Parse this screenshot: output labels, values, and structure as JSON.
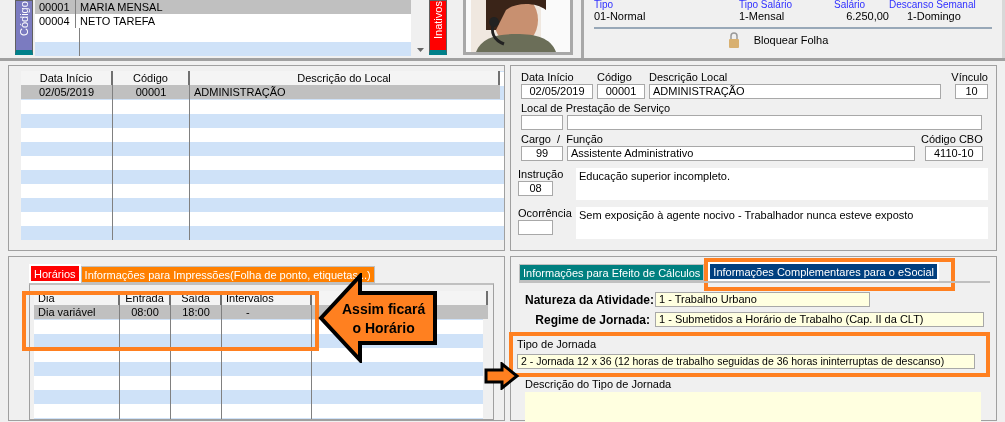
{
  "employees": {
    "side_tab": "Código",
    "rows": [
      {
        "code": "00001",
        "name": "MARIA MENSAL",
        "selected": true
      },
      {
        "code": "00004",
        "name": "NETO TAREFA",
        "selected": false
      }
    ],
    "status_tab": "Inativos"
  },
  "summary": {
    "fields": [
      {
        "label": "Tipo",
        "value": "01-Normal"
      },
      {
        "label": "Tipo Salário",
        "value": "1-Mensal"
      },
      {
        "label": "Salário",
        "value": "6.250,00"
      },
      {
        "label": "Descanso Semanal",
        "value": "1-Domingo"
      }
    ],
    "lock_button": "Bloquear Folha"
  },
  "locations": {
    "columns": [
      "Data Início",
      "Código",
      "Descrição do Local"
    ],
    "rows": [
      {
        "cells": [
          "02/05/2019",
          "00001",
          "ADMINISTRAÇÃO"
        ],
        "selected": true
      }
    ]
  },
  "location_form": {
    "data_inicio": {
      "label": "Data Início",
      "value": "02/05/2019"
    },
    "codigo": {
      "label": "Código",
      "value": "00001"
    },
    "descricao": {
      "label": "Descrição Local",
      "value": "ADMINISTRAÇÃO"
    },
    "vinculo": {
      "label": "Vínculo",
      "value": "10"
    },
    "prestacao": {
      "label": "Local de Prestação de Serviço"
    },
    "cargo": {
      "label": "Cargo  /  Função",
      "code": "99",
      "value": "Assistente Administrativo"
    },
    "cbo": {
      "label": "Código CBO",
      "value": "4110-10"
    },
    "instrucao": {
      "label": "Instrução",
      "code": "08",
      "value": "Educação superior incompleto."
    },
    "ocorrencia": {
      "label": "Ocorrência",
      "value": "Sem exposição à agente nocivo - Trabalhador nunca esteve exposto"
    }
  },
  "schedule_tabs": [
    {
      "label": "Horários",
      "selected": true,
      "color": "#ff0000"
    },
    {
      "label": "Informações para Impressões(Folha de ponto, etiquetas...)",
      "selected": false,
      "color": "#ff8000"
    }
  ],
  "schedule": {
    "columns": [
      "Dia",
      "Entrada",
      "Saída",
      "Intervalos"
    ],
    "rows": [
      {
        "cells": [
          "Dia variável",
          "08:00",
          "18:00",
          "-"
        ],
        "selected": true
      }
    ]
  },
  "annotation": {
    "lines": [
      "Assim ficará",
      "o Horário"
    ]
  },
  "esocial_tabs": [
    {
      "label": "Informações para Efeito de Cálculos",
      "selected": false,
      "highlighted": false,
      "color": "#008080"
    },
    {
      "label": "Informações Complementares para o eSocial",
      "selected": true,
      "highlighted": true,
      "color": "#003f7f"
    }
  ],
  "esocial": {
    "natureza": {
      "label": "Natureza da Atividade:",
      "value": "1 - Trabalho Urbano"
    },
    "regime": {
      "label": "Regime de Jornada:",
      "value": "1 - Submetidos a Horário de Trabalho (Cap. II da CLT)"
    },
    "tipo": {
      "label": "Tipo de Jornada",
      "highlighted": true,
      "value": "2 - Jornada 12 x 36 (12 horas de trabalho seguidas de 36 horas ininterruptas de descanso)"
    },
    "descricao": {
      "label": "Descrição do Tipo de Jornada"
    }
  }
}
